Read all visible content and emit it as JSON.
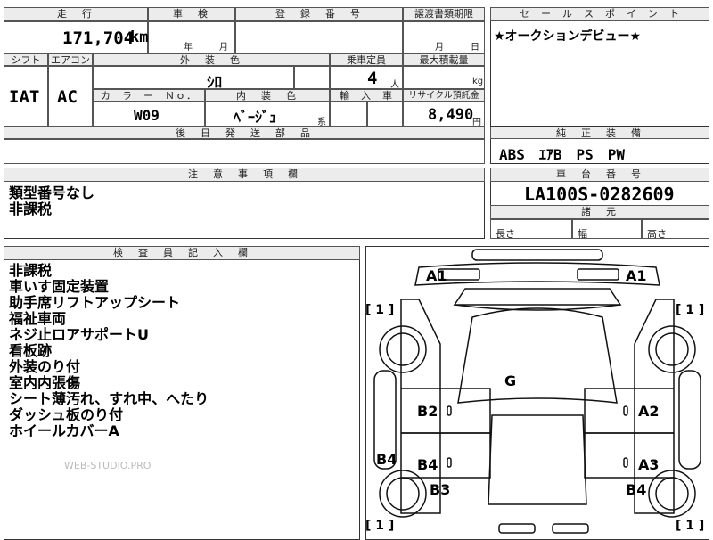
{
  "top_row": {
    "distance_header": "走　行",
    "distance_value": "171,704",
    "distance_unit": "km",
    "inspection_header": "車　検",
    "inspection_year": "年",
    "inspection_month": "月",
    "registration_header": "登　録　番　号",
    "transfer_header": "譲渡書類期限",
    "transfer_month": "月",
    "transfer_day": "日"
  },
  "row2": {
    "shift_header": "シフト",
    "shift_value": "IAT",
    "aircon_header": "エアコン",
    "aircon_value": "AC",
    "exterior_header": "外　装　色",
    "exterior_value": "ｼﾛ",
    "capacity_header": "乗車定員",
    "capacity_value": "4",
    "capacity_unit": "人",
    "max_load_header": "最大積載量",
    "max_load_unit": "kg",
    "color_no_header": "カ　ラ　ー　Ｎｏ．",
    "color_no_value": "W09",
    "interior_header": "内　装　色",
    "interior_value": "ﾍﾞｰｼﾞｭ",
    "interior_suffix": "系",
    "import_header": "輸　入　車",
    "recycle_header": "リサイクル預託金",
    "recycle_value": "8,490",
    "recycle_unit": "円",
    "parts_header": "後　日　発　送　部　品"
  },
  "sales_point": {
    "header": "セ　ー　ル　ス　ポ　イ　ン　ト",
    "text": "★オークションデビュー★"
  },
  "equipment": {
    "header": "純　正　装　備",
    "text": "ABS　ｴｱB　PS　PW"
  },
  "caution": {
    "header": "注　意　事　項　欄",
    "lines": [
      "類型番号なし",
      "非課税"
    ]
  },
  "chassis": {
    "header": "車　台　番　号",
    "value": "LA100S-0282609",
    "dims_header": "諸　元",
    "length_label": "長さ",
    "width_label": "幅",
    "height_label": "高さ"
  },
  "inspector": {
    "header": "検　査　員　記　入　欄",
    "lines": [
      "非課税",
      "車いす固定装置",
      "助手席リフトアップシート",
      "福祉車両",
      "ネジ止ロアサポートU",
      "看板跡",
      "外装のり付",
      "室内内張傷",
      "シート薄汚れ、すれ中、へたり",
      "ダッシュ板のり付",
      "ホイールカバーA"
    ],
    "watermark": "WEB-STUDIO.PRO"
  },
  "diagram": {
    "marks": {
      "a1_left": "A1",
      "a1_right": "A1",
      "g": "G",
      "b2": "B2",
      "a2": "A2",
      "b4_side": "B4",
      "b4_mid": "B4",
      "a3": "A3",
      "b3": "B3",
      "b4_right": "B4",
      "wheel_tl": "[ 1 ]",
      "wheel_tr": "[ 1 ]",
      "wheel_bl": "[ 1 ]",
      "wheel_br": "[ 1 ]"
    }
  }
}
